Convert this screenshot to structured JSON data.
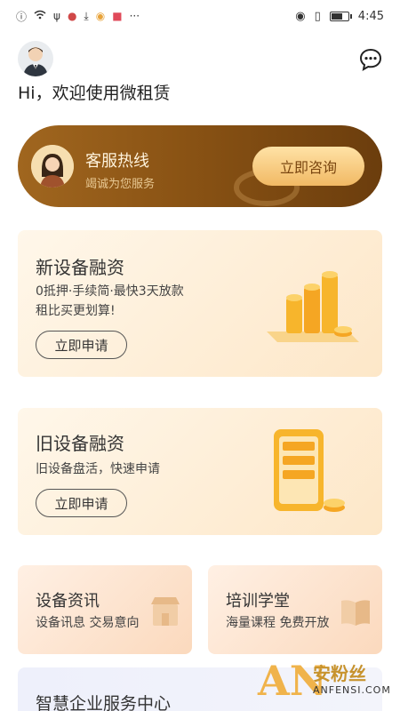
{
  "status_bar": {
    "time": "4:45",
    "left_icons": [
      "alert-icon",
      "wifi-icon",
      "usb-icon",
      "location-icon",
      "download-icon",
      "app-icon",
      "app-icon",
      "more-icon"
    ],
    "right_icons": [
      "eye-icon",
      "vibrate-icon",
      "battery-icon"
    ]
  },
  "header": {
    "greeting": "Hi，欢迎使用微租赁"
  },
  "hotline": {
    "title": "客服热线",
    "subtitle": "竭诚为您服务",
    "button": "立即咨询"
  },
  "cards": [
    {
      "title": "新设备融资",
      "desc_line1": "0抵押·手续简·最快3天放款",
      "desc_line2": "租比买更划算!",
      "button": "立即申请"
    },
    {
      "title": "旧设备融资",
      "desc_line1": "旧设备盘活，快速申请",
      "button": "立即申请"
    }
  ],
  "small_cards": [
    {
      "title": "设备资讯",
      "subtitle": "设备讯息 交易意向"
    },
    {
      "title": "培训学堂",
      "subtitle": "海量课程 免费开放"
    }
  ],
  "bottom_card": {
    "title": "智慧企业服务中心"
  },
  "watermark": {
    "logo": "AN",
    "name": "安粉丝",
    "domain": "ANFENSI.COM"
  },
  "colors": {
    "brand_brown": "#8a5314",
    "accent_gold": "#f1b964",
    "card_bg": "#fde7c8"
  }
}
